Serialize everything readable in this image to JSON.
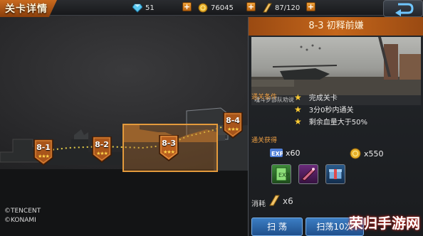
{
  "header": {
    "title": "关卡详情",
    "diamonds": "51",
    "gold": "76045",
    "stamina": "87/120",
    "plus": "+"
  },
  "stages": [
    {
      "label": "8-1",
      "stars": "★★★"
    },
    {
      "label": "8-2",
      "stars": "★★★"
    },
    {
      "label": "8-3",
      "stars": "★★★"
    },
    {
      "label": "8-4",
      "stars": "★★★"
    }
  ],
  "copyright": {
    "line1": "©TENCENT",
    "line2": "©KONAMI"
  },
  "panel": {
    "title": "8-3 初释前嫌",
    "preview_caption": "魂斗罗部队劝说",
    "conditions_heading": "通关条件",
    "conditions": [
      "完成关卡",
      "3分0秒内通关",
      "剩余血量大于50%"
    ],
    "rewards_heading": "通关获得",
    "exp_reward": "x60",
    "gold_reward": "x550",
    "cost_label": "消耗",
    "cost_value": "x6",
    "sweep_button": "扫 荡",
    "sweep10_button": "扫荡10次"
  },
  "watermark": "荣归手游网",
  "colors": {
    "accent_orange": "#c4661b",
    "star_yellow": "#ffcc33",
    "path_dots": "#e8d04a",
    "button_blue": "#2a64a8"
  }
}
